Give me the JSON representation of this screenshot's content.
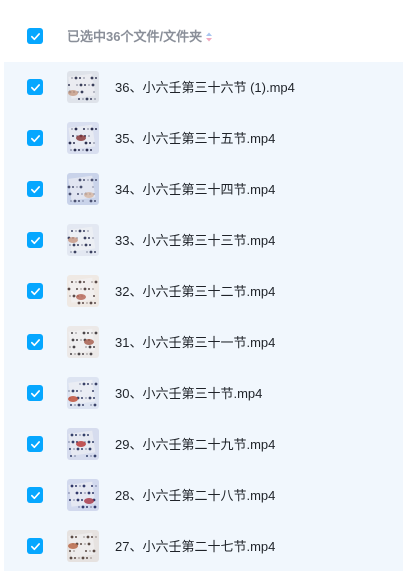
{
  "header": {
    "selection_text": "已选中36个文件/文件夹",
    "select_all_checked": true,
    "sort_icon": "sort-arrows-icon"
  },
  "colors": {
    "checkbox": "#06a7ff",
    "list_background": "#f1f7fd",
    "filename_text": "#1f2329",
    "header_text": "#8a8f99"
  },
  "files": [
    {
      "name": "36、小六壬第三十六节 (1).mp4",
      "checked": true,
      "thumb_icon": "video-thumbnail-icon"
    },
    {
      "name": "35、小六壬第三十五节.mp4",
      "checked": true,
      "thumb_icon": "video-thumbnail-icon"
    },
    {
      "name": "34、小六壬第三十四节.mp4",
      "checked": true,
      "thumb_icon": "video-thumbnail-icon"
    },
    {
      "name": "33、小六壬第三十三节.mp4",
      "checked": true,
      "thumb_icon": "video-thumbnail-icon"
    },
    {
      "name": "32、小六壬第三十二节.mp4",
      "checked": true,
      "thumb_icon": "video-thumbnail-icon"
    },
    {
      "name": "31、小六壬第三十一节.mp4",
      "checked": true,
      "thumb_icon": "video-thumbnail-icon"
    },
    {
      "name": "30、小六壬第三十节.mp4",
      "checked": true,
      "thumb_icon": "video-thumbnail-icon"
    },
    {
      "name": "29、小六壬第二十九节.mp4",
      "checked": true,
      "thumb_icon": "video-thumbnail-icon"
    },
    {
      "name": "28、小六壬第二十八节.mp4",
      "checked": true,
      "thumb_icon": "video-thumbnail-icon"
    },
    {
      "name": "27、小六壬第二十七节.mp4",
      "checked": true,
      "thumb_icon": "video-thumbnail-icon"
    }
  ]
}
